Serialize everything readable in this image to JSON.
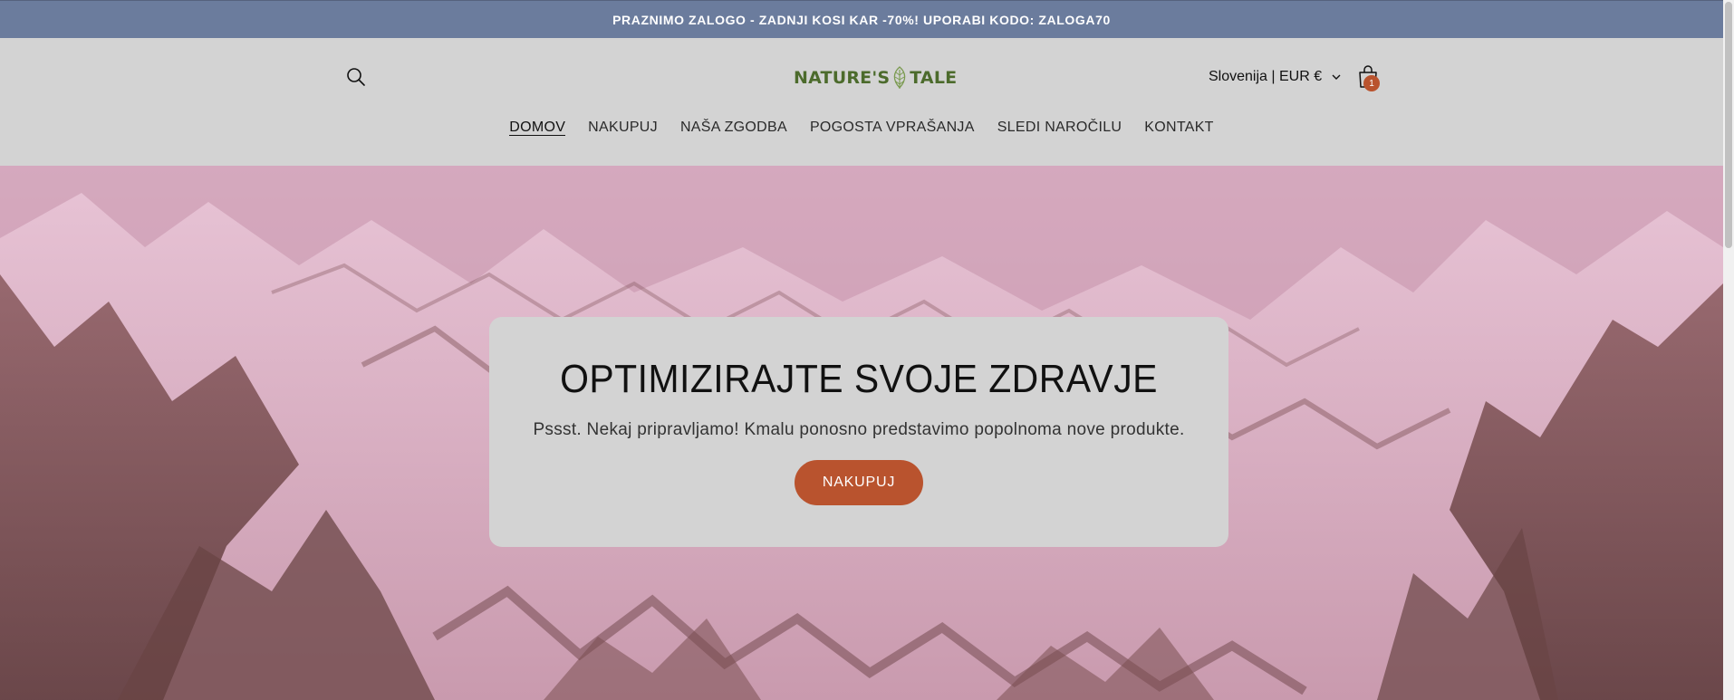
{
  "announcement": {
    "text": "PRAZNIMO ZALOGO - ZADNJI KOSI KAR -70%! UPORABI KODO: ZALOGA70"
  },
  "header": {
    "logo_left": "NATURE'S",
    "logo_right": "TALE",
    "locale": "Slovenija | EUR €",
    "cart_count": "1",
    "icons": {
      "search": "search-icon",
      "locale_chevron": "chevron-down-icon",
      "cart": "shopping-bag-icon",
      "logo_mark": "leaf-icon"
    }
  },
  "nav": {
    "items": [
      {
        "label": "DOMOV",
        "active": true
      },
      {
        "label": "NAKUPUJ",
        "active": false
      },
      {
        "label": "NAŠA ZGODBA",
        "active": false
      },
      {
        "label": "POGOSTA VPRAŠANJA",
        "active": false
      },
      {
        "label": "SLEDI NAROČILU",
        "active": false
      },
      {
        "label": "KONTAKT",
        "active": false
      }
    ]
  },
  "hero": {
    "title": "OPTIMIZIRAJTE SVOJE ZDRAVJE",
    "subtitle": "Pssst. Nekaj pripravljamo! Kmalu ponosno predstavimo popolnoma nove produkte.",
    "button_label": "NAKUPUJ"
  },
  "colors": {
    "announcement_bg": "#6b7c9d",
    "header_bg": "#d3d3d3",
    "accent": "#b9532e",
    "logo_green": "#4c6b2c"
  }
}
